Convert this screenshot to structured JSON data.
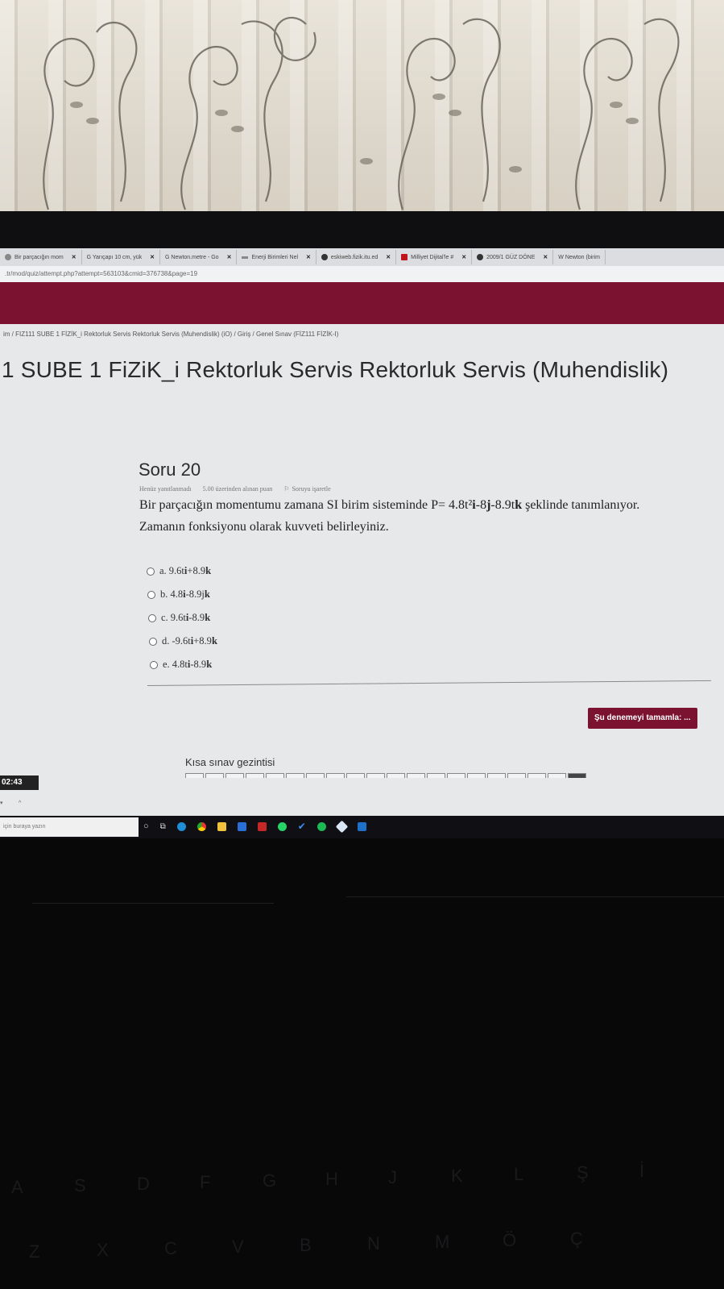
{
  "browser": {
    "tabs": [
      {
        "label": "Bir parçacığın mom",
        "icon": "page-icon"
      },
      {
        "label": "G  Yarıçapı 10 cm, yük",
        "icon": "google-icon"
      },
      {
        "label": "G  Newton.metre - Go",
        "icon": "google-icon"
      },
      {
        "label": "Enerji Birimleri Nel",
        "icon": "page-icon"
      },
      {
        "label": "eskiweb.fizik.itu.ed",
        "icon": "globe-icon"
      },
      {
        "label": "Milliyet Dijital'le #",
        "icon": "milliyet-icon"
      },
      {
        "label": "2009/1 GÜZ DÖNE",
        "icon": "globe-icon"
      },
      {
        "label": "W  Newton (birim",
        "icon": "wikipedia-icon"
      }
    ],
    "url": ".tr/mod/quiz/attempt.php?attempt=563103&cmid=376738&page=19"
  },
  "breadcrumb": "im  /  FIZ111 SUBE 1 FİZİK_i Rektorluk Servis Rektorluk Servis (Muhendislik) (iO)  /  Giriş  /  Genel Sınav (FİZ111 FİZİK-I)",
  "course_title": "1 SUBE 1 FiZiK_i Rektorluk Servis Rektorluk Servis (Muhendislik)",
  "question": {
    "heading": "Soru 20",
    "status": "Henüz yanıtlanmadı",
    "points": "5.00 üzerinden alınan puan",
    "flag_label": "Soruyu işaretle",
    "text_part1": "Bir parçacığın momentumu zamana SI birim sisteminde P= 4.8t²",
    "text_i": "i",
    "text_part2": "-8",
    "text_j": "j",
    "text_part3": "-8.9t",
    "text_k": "k",
    "text_part4": " şeklinde tanımlanıyor. Zamanın fonksiyonu olarak kuvveti belirleyiniz.",
    "answers": [
      {
        "prefix": "a. 9.6t",
        "bold1": "i",
        "mid": "+8.9",
        "bold2": "k",
        "selected": false
      },
      {
        "prefix": "b. 4.8",
        "bold1": "i",
        "mid": "-8.9j",
        "bold2": "k",
        "selected": false
      },
      {
        "prefix": "c. 9.6t",
        "bold1": "i",
        "mid": "-8.9",
        "bold2": "k",
        "selected": false
      },
      {
        "prefix": "d. -9.6t",
        "bold1": "i",
        "mid": "+8.9",
        "bold2": "k",
        "selected": false
      },
      {
        "prefix": "e. 4.8t",
        "bold1": "i",
        "mid": "-8.9",
        "bold2": "k",
        "selected": false
      }
    ]
  },
  "finish_button": "Şu denemeyi tamamla: ...",
  "nav": {
    "title": "Kısa sınav gezintisi",
    "current_page": 20
  },
  "timer": "02:43",
  "taskbar": {
    "search_placeholder": "için buraya yazın"
  },
  "keyboard_keys": [
    "A",
    "S",
    "D",
    "F",
    "G",
    "H",
    "J",
    "K",
    "L",
    "Ş",
    "İ",
    "Z",
    "X",
    "C",
    "V",
    "B",
    "N",
    "M",
    "Ö",
    "Ç"
  ]
}
